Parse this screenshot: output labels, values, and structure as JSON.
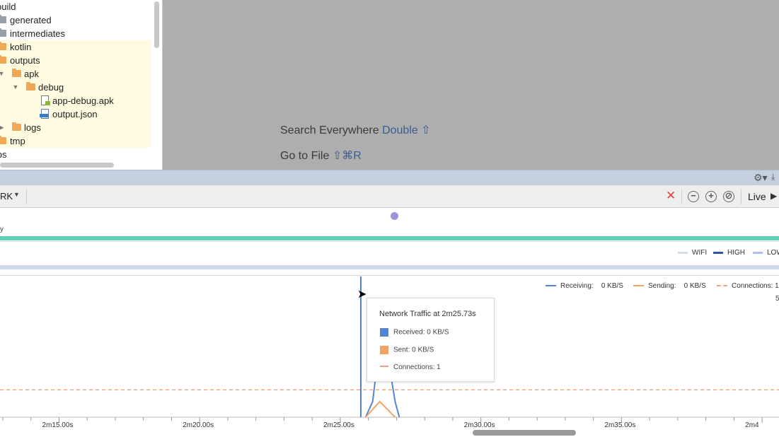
{
  "tree": {
    "items": [
      {
        "label": "build",
        "folder": "none"
      },
      {
        "label": "generated",
        "folder": "grey"
      },
      {
        "label": "intermediates",
        "folder": "grey"
      },
      {
        "label": "kotlin",
        "folder": "orange"
      },
      {
        "label": "outputs",
        "folder": "orange"
      },
      {
        "label": "apk",
        "folder": "orange"
      },
      {
        "label": "debug",
        "folder": "orange"
      },
      {
        "label": "app-debug.apk",
        "folder": "file-apk"
      },
      {
        "label": "output.json",
        "folder": "file-json"
      },
      {
        "label": "logs",
        "folder": "orange"
      },
      {
        "label": "tmp",
        "folder": "orange"
      },
      {
        "label": "libs",
        "folder": "none"
      }
    ]
  },
  "editor": {
    "search_label": "Search Everywhere",
    "search_key": "Double ⇧",
    "goto_label": "Go to File",
    "goto_key": "⇧⌘R"
  },
  "toolbar": {
    "session": "RK",
    "live_label": "Live",
    "zoom_out": "−",
    "zoom_in": "+",
    "reset_zoom": "⊘"
  },
  "energy": {
    "axis_tick": "y"
  },
  "radio_legend": [
    {
      "label": "WIFI",
      "color": "#d5dde9"
    },
    {
      "label": "HIGH",
      "color": "#2f56a6"
    },
    {
      "label": "LOW",
      "color": "#a9c3ee"
    }
  ],
  "network": {
    "legend": [
      {
        "label": "Receiving:",
        "value": "0 KB/S",
        "color": "#5585d2"
      },
      {
        "label": "Sending:",
        "value": "0 KB/S",
        "color": "#f2a366"
      },
      {
        "label": "Connections:",
        "value": "1",
        "color": "#f0a57a"
      }
    ],
    "tooltip": {
      "title": "Network Traffic at 2m25.73s",
      "received": "Received: 0 KB/S",
      "sent": "Sent: 0 KB/S",
      "connections": "Connections: 1"
    },
    "y_tick": "5",
    "colors": {
      "receiving": "#5585d2",
      "sending": "#f2a366",
      "connections": "#f0a57a",
      "cursor": "#4f7fd0"
    }
  },
  "chart_data": {
    "type": "line",
    "xlabel": "",
    "ylabel": "",
    "x_ticks": [
      "2m15.00s",
      "2m20.00s",
      "2m25.00s",
      "2m30.00s",
      "2m35.00s",
      "2m4"
    ],
    "x_tick_values": [
      135,
      140,
      145,
      150,
      155,
      160
    ],
    "xlim": [
      132.9,
      160.6
    ],
    "ylim": [
      0,
      8
    ],
    "cursor_x": 145.73,
    "series": [
      {
        "name": "Receiving",
        "x": [
          145.9,
          146.15,
          146.3,
          146.5,
          146.75,
          146.95,
          147.1
        ],
        "y": [
          0,
          1,
          3.2,
          3.6,
          3.2,
          1,
          0
        ]
      },
      {
        "name": "Sending",
        "x": [
          145.9,
          146.4,
          146.95
        ],
        "y": [
          0,
          1,
          0
        ]
      },
      {
        "name": "Connections",
        "x": [
          132.9,
          160.6
        ],
        "y": [
          1.75,
          1.75
        ]
      }
    ]
  }
}
